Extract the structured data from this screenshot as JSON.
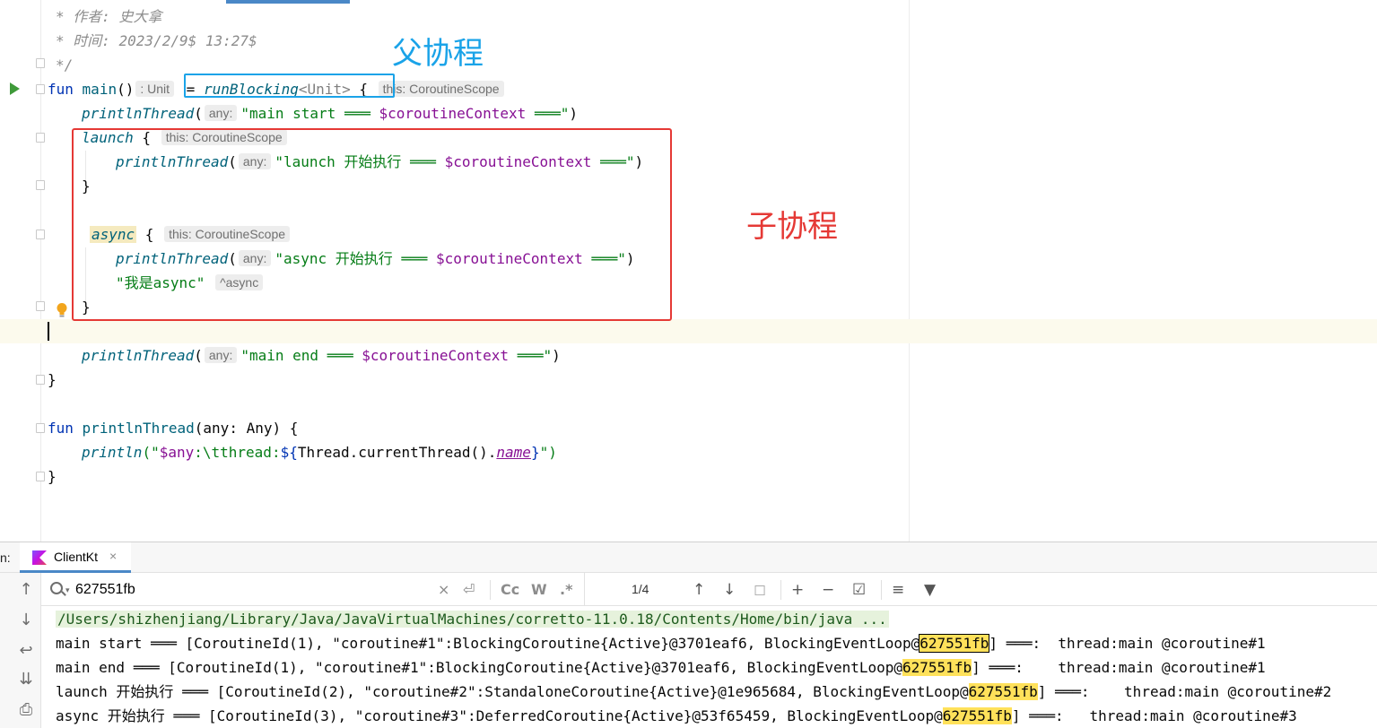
{
  "editor": {
    "comment_author": "* 作者: 史大拿",
    "comment_time": "* 时间: 2023/2/9$ 13:27$",
    "comment_end": "*/",
    "kw_fun": "fun",
    "main_name": "main",
    "paren_open_close": "()",
    "hint_unit": ": Unit",
    "eq": "= ",
    "run_blocking": "runBlocking",
    "unit_generic": "<Unit>",
    "brace_open": " {",
    "hint_scope": "this: CoroutineScope",
    "println_thread": "printlnThread",
    "paren_open": "(",
    "hint_any": "any:",
    "str_main_start": "\"main start ═══ ",
    "tpl_ctx": "$coroutineContext",
    "str_tail": " ═══\"",
    "paren_close": ")",
    "kw_launch": "launch",
    "str_launch": "\"launch 开始执行 ═══ ",
    "brace_close": "}",
    "kw_async": "async",
    "str_async": "\"async 开始执行 ═══ ",
    "str_async_ret": "\"我是async\"",
    "hint_async": "^async",
    "str_main_end": "\"main end ═══ ",
    "fn_decl_name": "printlnThread",
    "fn_decl_params": "(any: Any) {",
    "println": "println",
    "str_print_open": "(\"",
    "tpl_any": "$any",
    "str_colon_tab": ":\\t",
    "str_thread": "thread:",
    "tpl_open": "${",
    "thread_call": "Thread.currentThread().",
    "prop_name": "name",
    "tpl_close": "}",
    "str_print_close": "\")"
  },
  "annotations": {
    "parent_label": "父协程",
    "child_label": "子协程",
    "parent_color": "#1aa3e8",
    "child_color": "#e53935"
  },
  "tool_window": {
    "prefix": "n:",
    "tab_label": "ClientKt",
    "tab_close": "×",
    "search_value": "627551fb",
    "match_count": "1/4",
    "cc_label": "Cc",
    "w_label": "W",
    "regex_label": ".*"
  },
  "console": {
    "path": "/Users/shizhenjiang/Library/Java/JavaVirtualMachines/corretto-11.0.18/Contents/Home/bin/java ...",
    "lines": [
      {
        "pre": "main start ═══ [CoroutineId(1), \"coroutine#1\":BlockingCoroutine{Active}@3701eaf6, BlockingEventLoop@",
        "match": "627551fb",
        "post": "] ═══:  thread:main @coroutine#1"
      },
      {
        "pre": "main end ═══ [CoroutineId(1), \"coroutine#1\":BlockingCoroutine{Active}@3701eaf6, BlockingEventLoop@",
        "match": "627551fb",
        "post": "] ═══:    thread:main @coroutine#1"
      },
      {
        "pre": "launch 开始执行 ═══ [CoroutineId(2), \"coroutine#2\":StandaloneCoroutine{Active}@1e965684, BlockingEventLoop@",
        "match": "627551fb",
        "post": "] ═══:    thread:main @coroutine#2"
      },
      {
        "pre": "async 开始执行 ═══ [CoroutineId(3), \"coroutine#3\":DeferredCoroutine{Active}@53f65459, BlockingEventLoop@",
        "match": "627551fb",
        "post": "] ═══:   thread:main @coroutine#3"
      }
    ]
  }
}
